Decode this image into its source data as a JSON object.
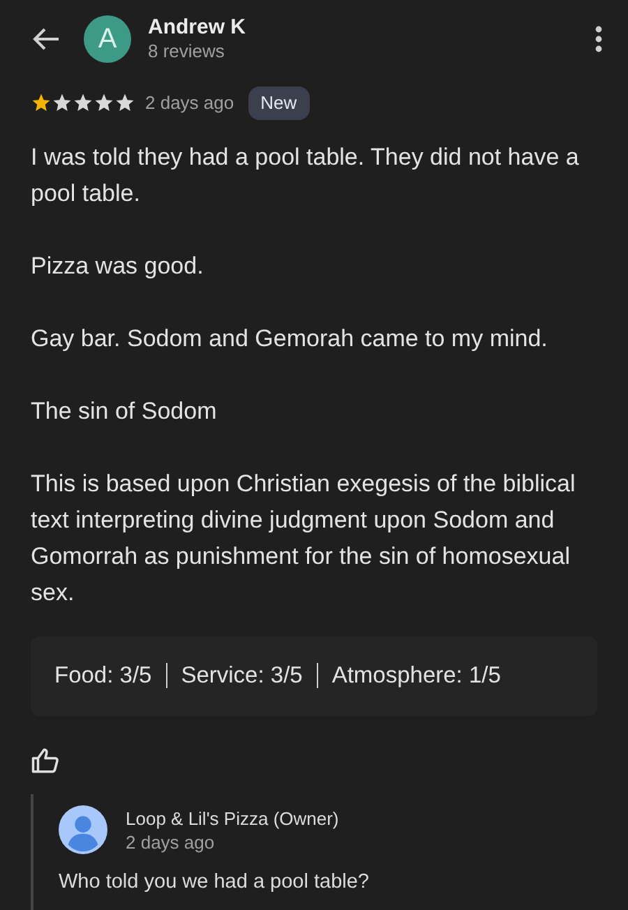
{
  "reviewer": {
    "initial": "A",
    "name": "Andrew K",
    "reviews": "8 reviews"
  },
  "review": {
    "stars": 1,
    "time": "2 days ago",
    "badge": "New",
    "paragraphs": [
      "I was told they had a pool table. They did not have a pool table.",
      "Pizza was good.",
      "Gay bar. Sodom and Gemorah came to my mind.",
      "The sin of Sodom",
      "This is based upon Christian exegesis of the biblical text interpreting divine judgment upon Sodom and Gomorrah as punishment for the sin of homosexual sex."
    ],
    "ratings": [
      "Food: 3/5",
      "Service: 3/5",
      "Atmosphere: 1/5"
    ]
  },
  "owner_reply": {
    "name": "Loop & Lil's Pizza (Owner)",
    "time": "2 days ago",
    "text": "Who told you we had a pool table?"
  }
}
